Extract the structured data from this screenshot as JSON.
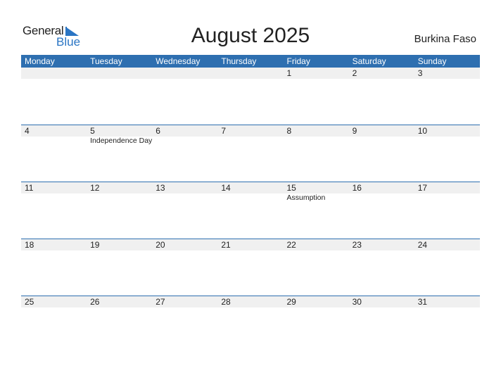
{
  "logo": {
    "word1": "General",
    "word2": "Blue"
  },
  "title": "August 2025",
  "country": "Burkina Faso",
  "colors": {
    "accent": "#2e6fb0",
    "band": "#f0f0f0",
    "logo_blue": "#2a75c4"
  },
  "weekdays": [
    "Monday",
    "Tuesday",
    "Wednesday",
    "Thursday",
    "Friday",
    "Saturday",
    "Sunday"
  ],
  "weeks": [
    [
      {
        "d": ""
      },
      {
        "d": ""
      },
      {
        "d": ""
      },
      {
        "d": ""
      },
      {
        "d": "1"
      },
      {
        "d": "2"
      },
      {
        "d": "3"
      }
    ],
    [
      {
        "d": "4"
      },
      {
        "d": "5",
        "event": "Independence Day"
      },
      {
        "d": "6"
      },
      {
        "d": "7"
      },
      {
        "d": "8"
      },
      {
        "d": "9"
      },
      {
        "d": "10"
      }
    ],
    [
      {
        "d": "11"
      },
      {
        "d": "12"
      },
      {
        "d": "13"
      },
      {
        "d": "14"
      },
      {
        "d": "15",
        "event": "Assumption"
      },
      {
        "d": "16"
      },
      {
        "d": "17"
      }
    ],
    [
      {
        "d": "18"
      },
      {
        "d": "19"
      },
      {
        "d": "20"
      },
      {
        "d": "21"
      },
      {
        "d": "22"
      },
      {
        "d": "23"
      },
      {
        "d": "24"
      }
    ],
    [
      {
        "d": "25"
      },
      {
        "d": "26"
      },
      {
        "d": "27"
      },
      {
        "d": "28"
      },
      {
        "d": "29"
      },
      {
        "d": "30"
      },
      {
        "d": "31"
      }
    ]
  ]
}
